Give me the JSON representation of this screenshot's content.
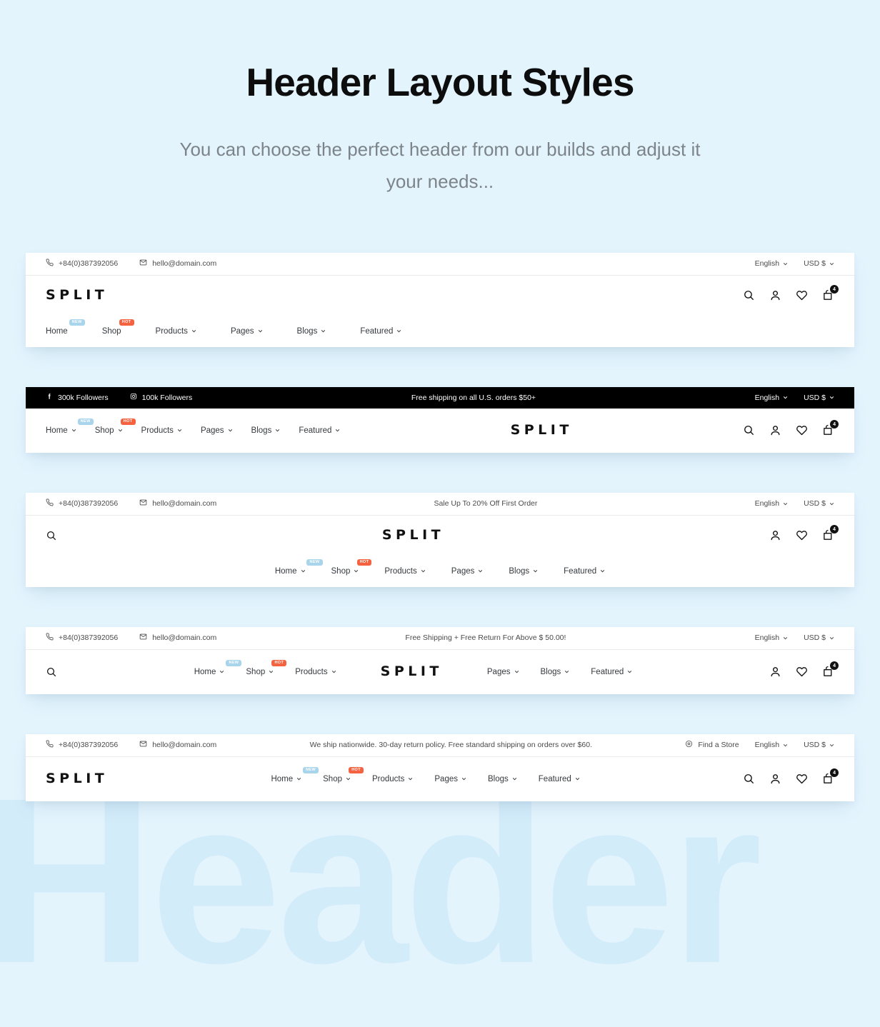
{
  "page": {
    "title": "Header Layout Styles",
    "subtitle": "You can choose the perfect header from our builds and adjust it your needs...",
    "watermark": "Header",
    "background_color": "#e3f4fd",
    "watermark_color": "#d3ecfa",
    "accent_hot": "#f4623f",
    "accent_new": "#a8d4ec"
  },
  "common": {
    "phone": "+84(0)387392056",
    "email": "hello@domain.com",
    "language": "English",
    "currency": "USD $",
    "brand": "SPLIT",
    "cart_count": "4",
    "find_a_store": "Find a Store",
    "nav": {
      "home": "Home",
      "shop": "Shop",
      "products": "Products",
      "pages": "Pages",
      "blogs": "Blogs",
      "featured": "Featured"
    },
    "badges": {
      "new": "NEW",
      "hot": "HOT"
    },
    "icons": {
      "phone": "phone-icon",
      "mail": "mail-icon",
      "search": "search-icon",
      "account": "user-icon",
      "wishlist": "heart-icon",
      "cart": "cart-icon",
      "chevron": "chevron-down-icon",
      "facebook": "facebook-icon",
      "instagram": "instagram-icon",
      "location": "location-pin-icon"
    }
  },
  "headers": [
    {
      "id": "header-1",
      "topbar_style": "light",
      "announcement": "",
      "social": []
    },
    {
      "id": "header-2",
      "topbar_style": "dark",
      "announcement": "Free shipping on all U.S. orders $50+",
      "social": [
        {
          "label": "300k Followers",
          "network": "facebook"
        },
        {
          "label": "100k Followers",
          "network": "instagram"
        }
      ]
    },
    {
      "id": "header-3",
      "topbar_style": "light",
      "announcement": "Sale Up To 20% Off First Order",
      "social": []
    },
    {
      "id": "header-4",
      "topbar_style": "light",
      "announcement": "Free Shipping + Free Return For Above $ 50.00!",
      "social": []
    },
    {
      "id": "header-5",
      "topbar_style": "light",
      "announcement": "We ship nationwide. 30-day return policy. Free standard shipping on orders over $60.",
      "social": []
    }
  ]
}
